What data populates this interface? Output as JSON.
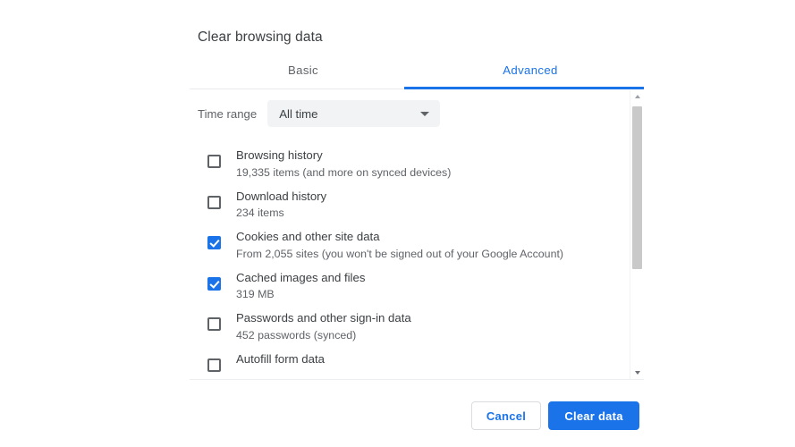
{
  "dialog": {
    "title": "Clear browsing data"
  },
  "tabs": [
    {
      "label": "Basic",
      "active": false
    },
    {
      "label": "Advanced",
      "active": true
    }
  ],
  "time_range": {
    "label": "Time range",
    "value": "All time",
    "arrow_icon": "chevron-down-icon"
  },
  "items": [
    {
      "title": "Browsing history",
      "subtitle": "19,335 items (and more on synced devices)",
      "checked": false
    },
    {
      "title": "Download history",
      "subtitle": "234 items",
      "checked": false
    },
    {
      "title": "Cookies and other site data",
      "subtitle": "From 2,055 sites (you won't be signed out of your Google Account)",
      "checked": true
    },
    {
      "title": "Cached images and files",
      "subtitle": "319 MB",
      "checked": true
    },
    {
      "title": "Passwords and other sign-in data",
      "subtitle": "452 passwords (synced)",
      "checked": false
    },
    {
      "title": "Autofill form data",
      "subtitle": "",
      "checked": false
    }
  ],
  "scrollbar": {
    "up_icon": "scroll-up-arrow-icon",
    "down_icon": "scroll-down-arrow-icon"
  },
  "footer": {
    "cancel_label": "Cancel",
    "confirm_label": "Clear data"
  },
  "colors": {
    "accent": "#1a73e8",
    "primary_text": "#3c4043",
    "secondary_text": "#5f6368",
    "select_background": "#f1f3f4",
    "divider": "#e8eaed",
    "scroll_thumb": "#c9c9c9"
  }
}
